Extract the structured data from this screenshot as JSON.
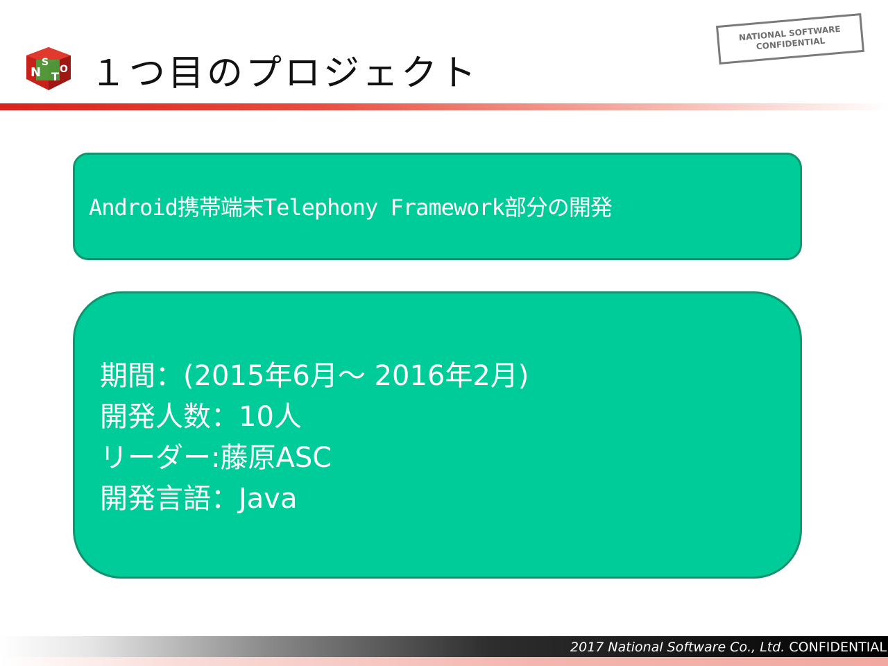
{
  "header": {
    "logo_text": "NSTO",
    "title": "１つ目のプロジェクト"
  },
  "stamp": {
    "line1": "NATIONAL SOFTWARE",
    "line2": "CONFIDENTIAL"
  },
  "project": {
    "summary": "Android携帯端末Telephony Framework部分の開発",
    "details": [
      "期間：(2015年6月～ 2016年2月)",
      "開発人数：10人",
      "リーダー:藤原ASC",
      "開発言語：Java"
    ]
  },
  "footer": {
    "copyright": "2017 National Software Co., Ltd.",
    "label": "CONFIDENTIAL"
  },
  "colors": {
    "box_fill": "#00cc99",
    "box_border": "#12936e",
    "accent_red": "#d9231c"
  }
}
